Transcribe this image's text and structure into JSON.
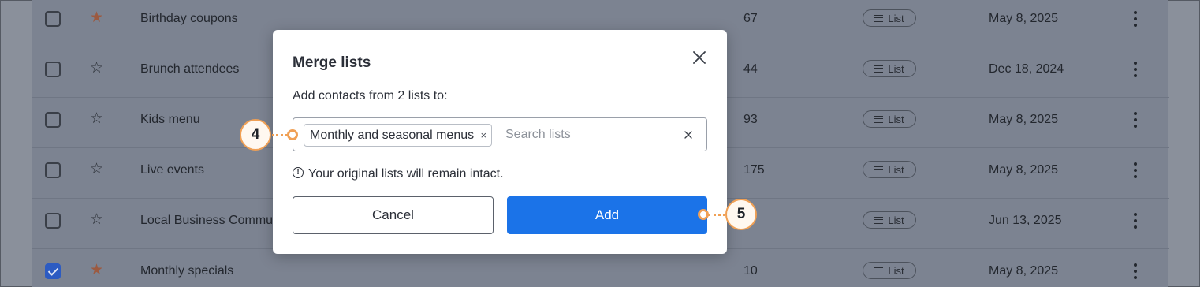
{
  "table": {
    "rows": [
      {
        "name": "Birthday coupons",
        "count": "67",
        "type": "List",
        "date": "May 8, 2025",
        "starred": true,
        "checked": false
      },
      {
        "name": "Brunch attendees",
        "count": "44",
        "type": "List",
        "date": "Dec 18, 2024",
        "starred": false,
        "checked": false
      },
      {
        "name": "Kids menu",
        "count": "93",
        "type": "List",
        "date": "May 8, 2025",
        "starred": false,
        "checked": false
      },
      {
        "name": "Live events",
        "count": "175",
        "type": "List",
        "date": "May 8, 2025",
        "starred": false,
        "checked": false
      },
      {
        "name": "Local Business Commu",
        "count": "",
        "type": "List",
        "date": "Jun 13, 2025",
        "starred": false,
        "checked": false
      },
      {
        "name": "Monthly specials",
        "count": "10",
        "type": "List",
        "date": "May 8, 2025",
        "starred": true,
        "checked": true
      }
    ]
  },
  "modal": {
    "title": "Merge lists",
    "subtitle": "Add contacts from 2 lists to:",
    "selected_chip": "Monthly and seasonal menus",
    "chip_remove": "×",
    "search_placeholder": "Search lists",
    "note": "Your original lists will remain intact.",
    "note_icon": "!",
    "cancel_label": "Cancel",
    "add_label": "Add"
  },
  "callouts": {
    "first": "4",
    "second": "5"
  },
  "colors": {
    "primary": "#1b73e8",
    "callout_orange": "#f0a055",
    "star_filled": "#9c5a40",
    "checkbox_checked": "#2c5bc2"
  }
}
